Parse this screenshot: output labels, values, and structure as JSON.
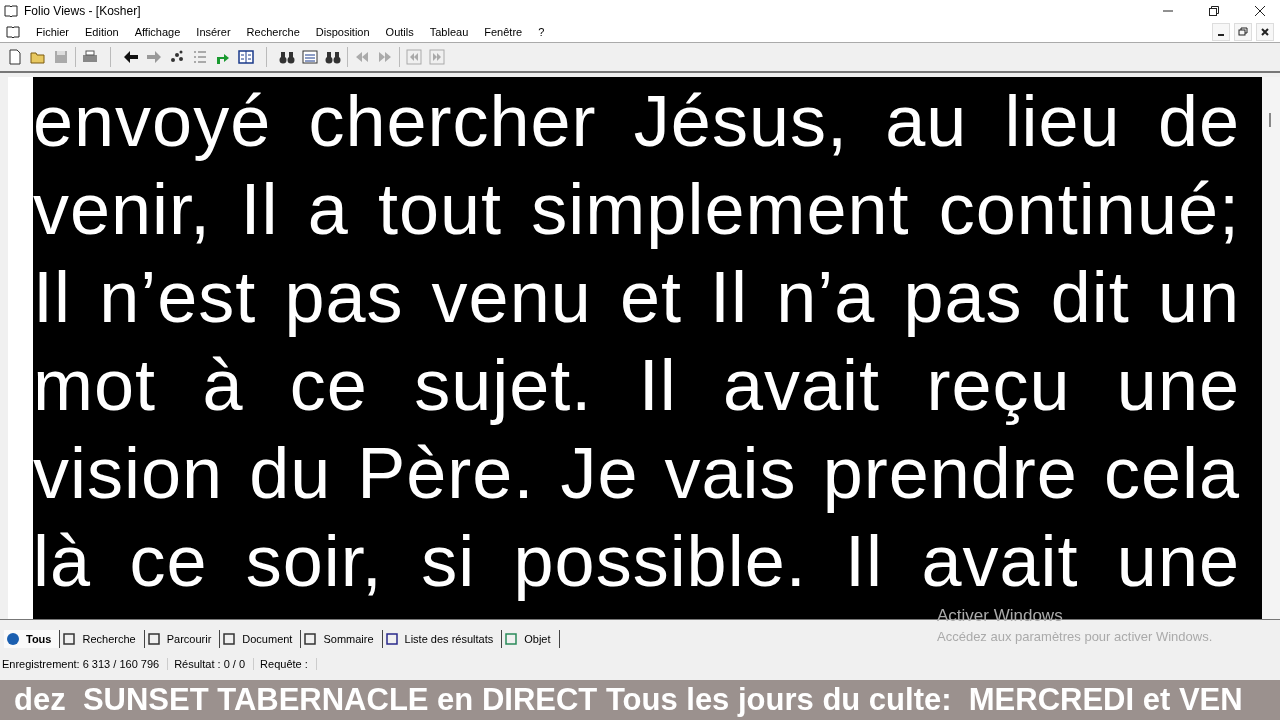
{
  "window": {
    "title": "Folio Views - [Kosher]"
  },
  "menu": [
    "Fichier",
    "Edition",
    "Affichage",
    "Insérer",
    "Recherche",
    "Disposition",
    "Outils",
    "Tableau",
    "Fenêtre",
    "?"
  ],
  "document": {
    "lines": [
      "envoyé chercher Jésus, au lieu de",
      "venir, Il a tout simplement continué;",
      "Il n’est pas venu et Il n’a pas dit un",
      "mot à ce sujet. Il avait reçu une",
      "vision du Père. Je vais prendre cela",
      "là ce soir, si possible. Il avait une"
    ]
  },
  "tabs": [
    {
      "label": "Tous",
      "selected": true
    },
    {
      "label": "Recherche",
      "selected": false
    },
    {
      "label": "Parcourir",
      "selected": false
    },
    {
      "label": "Document",
      "selected": false
    },
    {
      "label": "Sommaire",
      "selected": false
    },
    {
      "label": "Liste des résultats",
      "selected": false
    },
    {
      "label": "Objet",
      "selected": false
    }
  ],
  "activation": {
    "title": "Activer Windows",
    "text": "Accédez aux paramètres pour activer Windows."
  },
  "status_bar": [
    "Enregistrement: 6 313 / 160 796",
    "Résultat : 0 / 0",
    "Requête :"
  ],
  "ticker": {
    "text": "dez  SUNSET TABERNACLE en DIRECT Tous les jours du culte:  MERCREDI et VEN"
  }
}
